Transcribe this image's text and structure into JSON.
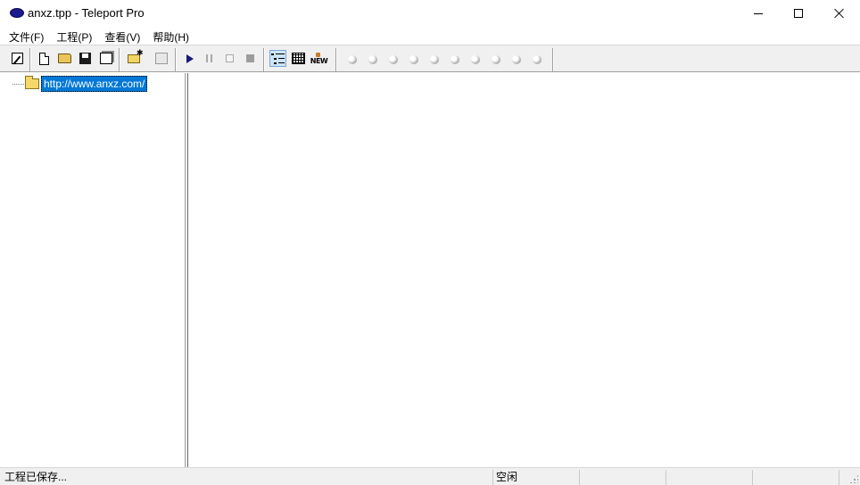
{
  "window": {
    "title": "anxz.tpp - Teleport Pro",
    "app_icon": "teleport-pro-icon",
    "controls": [
      "minimize-icon",
      "maximize-icon",
      "close-icon"
    ]
  },
  "menu": {
    "items": [
      {
        "label": "文件(F)"
      },
      {
        "label": "工程(P)"
      },
      {
        "label": "查看(V)"
      },
      {
        "label": "帮助(H)"
      }
    ]
  },
  "toolbar": {
    "groups": [
      [
        "project-wizard-icon"
      ],
      [
        "new-document-icon",
        "open-folder-icon",
        "save-icon",
        "properties-icon"
      ],
      [
        "new-starting-address-icon",
        "browse-icon"
      ],
      [
        "start-icon",
        "pause-icon",
        "stop-after-icon",
        "stop-icon"
      ],
      [
        "tree-view-icon",
        "table-view-icon",
        "new-files-icon"
      ],
      [
        "thread-1-icon",
        "thread-2-icon",
        "thread-3-icon",
        "thread-4-icon",
        "thread-5-icon",
        "thread-6-icon",
        "thread-7-icon",
        "thread-8-icon",
        "thread-9-icon",
        "thread-10-icon"
      ]
    ],
    "pressed": "tree-view-icon"
  },
  "tree": {
    "items": [
      {
        "label": "http://www.anxz.com/",
        "icon": "folder-icon",
        "selected": true
      }
    ]
  },
  "statusbar": {
    "message": "工程已保存...",
    "state": "空闲"
  },
  "colors": {
    "selection": "#0078d7",
    "toolbar_bg": "#f0f0f0",
    "pressed_bg": "#cce4f7",
    "app_icon": "#1b1b8e"
  }
}
